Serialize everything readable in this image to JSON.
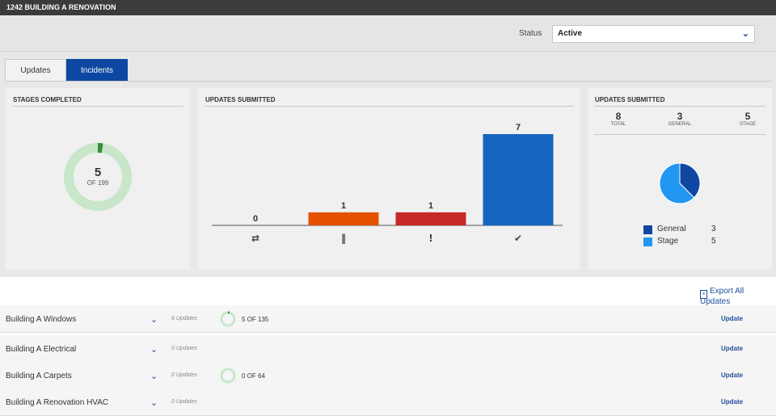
{
  "header": {
    "title": "1242 BUILDING A RENOVATION"
  },
  "status": {
    "label": "Status",
    "value": "Active"
  },
  "tabs": [
    {
      "label": "Updates"
    },
    {
      "label": "Incidents"
    }
  ],
  "stages_panel": {
    "title": "STAGES COMPLETED",
    "completed": "5",
    "total_text": "OF 199",
    "completed_fraction": 0.025
  },
  "bar_panel": {
    "title": "UPDATES SUBMITTED"
  },
  "summary_panel": {
    "title": "UPDATES SUBMITTED",
    "total": {
      "value": "8",
      "label": "TOTAL"
    },
    "general": {
      "value": "3",
      "label": "GENERAL"
    },
    "stage": {
      "value": "5",
      "label": "STAGE"
    }
  },
  "chart_data": [
    {
      "type": "bar",
      "categories": [
        "in-progress-icon",
        "paused-icon",
        "alert-icon",
        "complete-icon"
      ],
      "values": [
        0,
        1,
        1,
        7
      ],
      "colors": [
        "#9e9e9e",
        "#e65100",
        "#c62828",
        "#1565c0"
      ],
      "ylim": [
        0,
        7
      ],
      "title": "UPDATES SUBMITTED"
    },
    {
      "type": "pie",
      "categories": [
        "General",
        "Stage"
      ],
      "values": [
        3,
        5
      ],
      "colors": [
        "#0d47a1",
        "#2196f3"
      ],
      "legend": "bottom"
    }
  ],
  "export": {
    "label": "Export All Updates"
  },
  "rows": [
    {
      "name": "Building A Windows",
      "count": "6 Updates",
      "stage": "5 OF 135",
      "fraction": 0.037,
      "action": "Update"
    },
    {
      "name": "Building A Electrical",
      "count": "0 Updates",
      "stage": "",
      "fraction": null,
      "action": "Update"
    },
    {
      "name": "Building A Carpets",
      "count": "0 Updates",
      "stage": "0 OF 64",
      "fraction": 0,
      "action": "Update"
    },
    {
      "name": "Building A Renovation HVAC",
      "count": "0 Updates",
      "stage": "",
      "fraction": null,
      "action": "Update"
    }
  ],
  "colors": {
    "accent": "#0d47a1",
    "ring_track": "#c8e6c9",
    "ring_fill": "#388e3c"
  }
}
